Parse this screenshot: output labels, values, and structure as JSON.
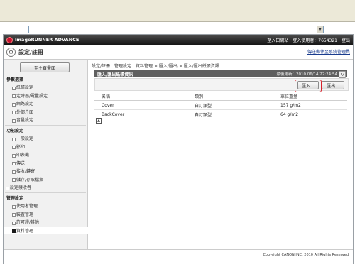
{
  "browser": {
    "address_value": "",
    "dropdown_icon": "chevron-down-icon"
  },
  "header": {
    "app_name": "imageRUNNER ADVANCE",
    "links": [
      "至入口網站",
      "登入使用者：7654321",
      "登出"
    ]
  },
  "titlebar": {
    "title": "設定/註冊",
    "link": "傳送郵件至系統管理員"
  },
  "sidebar": {
    "home_button": "至主頁畫面",
    "items": [
      {
        "label": "參數選擇",
        "kind": "section"
      },
      {
        "label": "紙張設定",
        "kind": "child"
      },
      {
        "label": "定時器/電量設定",
        "kind": "child"
      },
      {
        "label": "網路設定",
        "kind": "child"
      },
      {
        "label": "外部介面",
        "kind": "child"
      },
      {
        "label": "音量設定",
        "kind": "child"
      },
      {
        "label": "功能設定",
        "kind": "section"
      },
      {
        "label": "一般設定",
        "kind": "child"
      },
      {
        "label": "影印",
        "kind": "child"
      },
      {
        "label": "印表機",
        "kind": "child"
      },
      {
        "label": "傳送",
        "kind": "child"
      },
      {
        "label": "接收/轉寄",
        "kind": "child"
      },
      {
        "label": "儲存/存取檔案",
        "kind": "child"
      },
      {
        "label": "設定接收者",
        "kind": "top"
      },
      {
        "label": "管理設定",
        "kind": "section"
      },
      {
        "label": "使用者管理",
        "kind": "child"
      },
      {
        "label": "裝置管理",
        "kind": "child"
      },
      {
        "label": "許可證/其他",
        "kind": "child"
      },
      {
        "label": "資料管理",
        "kind": "child",
        "active": true
      }
    ]
  },
  "main": {
    "breadcrumb": "設定/註冊：管理設定：資料管理 > 匯入/匯出 > 匯入/匯出紙張資訊",
    "panel_title": "匯入/匯出紙張資訊",
    "last_updated": "最後更新：2010 06/14 22:24:54",
    "refresh_icon": "refresh-icon",
    "import_button": "匯入...",
    "export_button": "匯出...",
    "table": {
      "headers": [
        "名稱",
        "類別",
        "單位重量"
      ],
      "rows": [
        [
          "Cover",
          "自訂類型",
          "157 g/m2"
        ],
        [
          "BackCover",
          "自訂類型",
          "64 g/m2"
        ]
      ]
    },
    "to_top_icon": "arrow-up-icon"
  },
  "footer": {
    "copyright": "Copyright CANON INC. 2010 All Rights Reserved"
  },
  "colors": {
    "header_bg": "#1f1f1f",
    "panel_bg": "#5f5f5f",
    "highlight": "#d8202a",
    "sidebar_bg": "#f1f1f1"
  }
}
